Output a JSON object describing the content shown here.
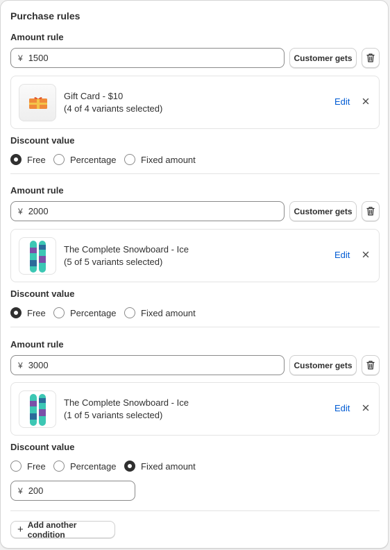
{
  "section_title": "Purchase rules",
  "amount_rule_label": "Amount rule",
  "customer_gets_label": "Customer gets",
  "discount_value_label": "Discount value",
  "edit_label": "Edit",
  "currency_symbol": "¥",
  "add_condition_label": "Add another condition",
  "radio_options": [
    "Free",
    "Percentage",
    "Fixed amount"
  ],
  "rules": [
    {
      "amount": "1500",
      "product_name": "Gift Card - $10",
      "variants": "(4 of 4 variants selected)",
      "thumb_icon": "gift-card-icon",
      "selected_discount": "Free"
    },
    {
      "amount": "2000",
      "product_name": "The Complete Snowboard - Ice",
      "variants": "(5 of 5 variants selected)",
      "thumb_icon": "snowboard-icon",
      "selected_discount": "Free"
    },
    {
      "amount": "3000",
      "product_name": "The Complete Snowboard - Ice",
      "variants": "(1 of 5 variants selected)",
      "thumb_icon": "snowboard-icon",
      "selected_discount": "Fixed amount",
      "fixed_amount_value": "200"
    }
  ],
  "colors": {
    "accent_link": "#005bd3",
    "text": "#303030",
    "border": "#8a8a8a"
  }
}
